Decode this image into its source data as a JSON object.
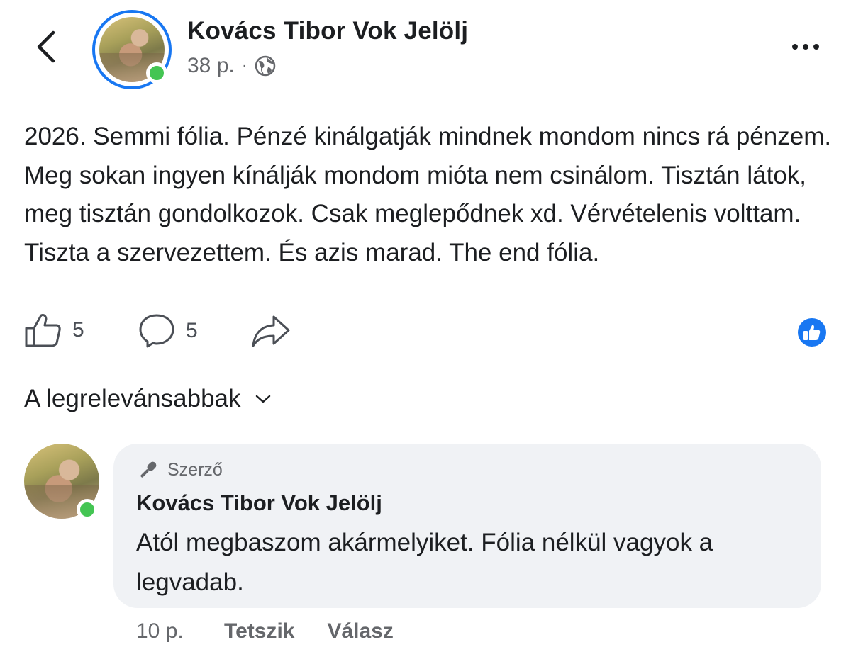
{
  "header": {
    "author": "Kovács Tibor Vok Jelölj",
    "time": "38 p.",
    "separator": "·",
    "audience_icon": "globe-icon"
  },
  "post": {
    "text": "2026. Semmi fólia. Pénzé kinálgatják mindnek mondom nincs rá pénzem. Meg sokan ingyen kínálják mondom mióta nem csinálom. Tisztán látok, meg tisztán gondolkozok. Csak meglepődnek xd. Vérvételenis volttam. Tiszta a szervezettem. És azis marad. The end fólia."
  },
  "actions": {
    "likes": "5",
    "comments": "5"
  },
  "sort": {
    "label": "A legrelevánsabbak"
  },
  "comment": {
    "badge": "Szerző",
    "author": "Kovács Tibor Vok Jelölj",
    "text": "Atól megbaszom akármelyiket. Fólia nélkül vagyok a legvadab.",
    "time": "10 p.",
    "like_label": "Tetszik",
    "reply_label": "Válasz"
  },
  "colors": {
    "accent": "#1877f2",
    "online": "#44c553",
    "bubble": "#f0f2f5",
    "muted": "#65676b"
  }
}
